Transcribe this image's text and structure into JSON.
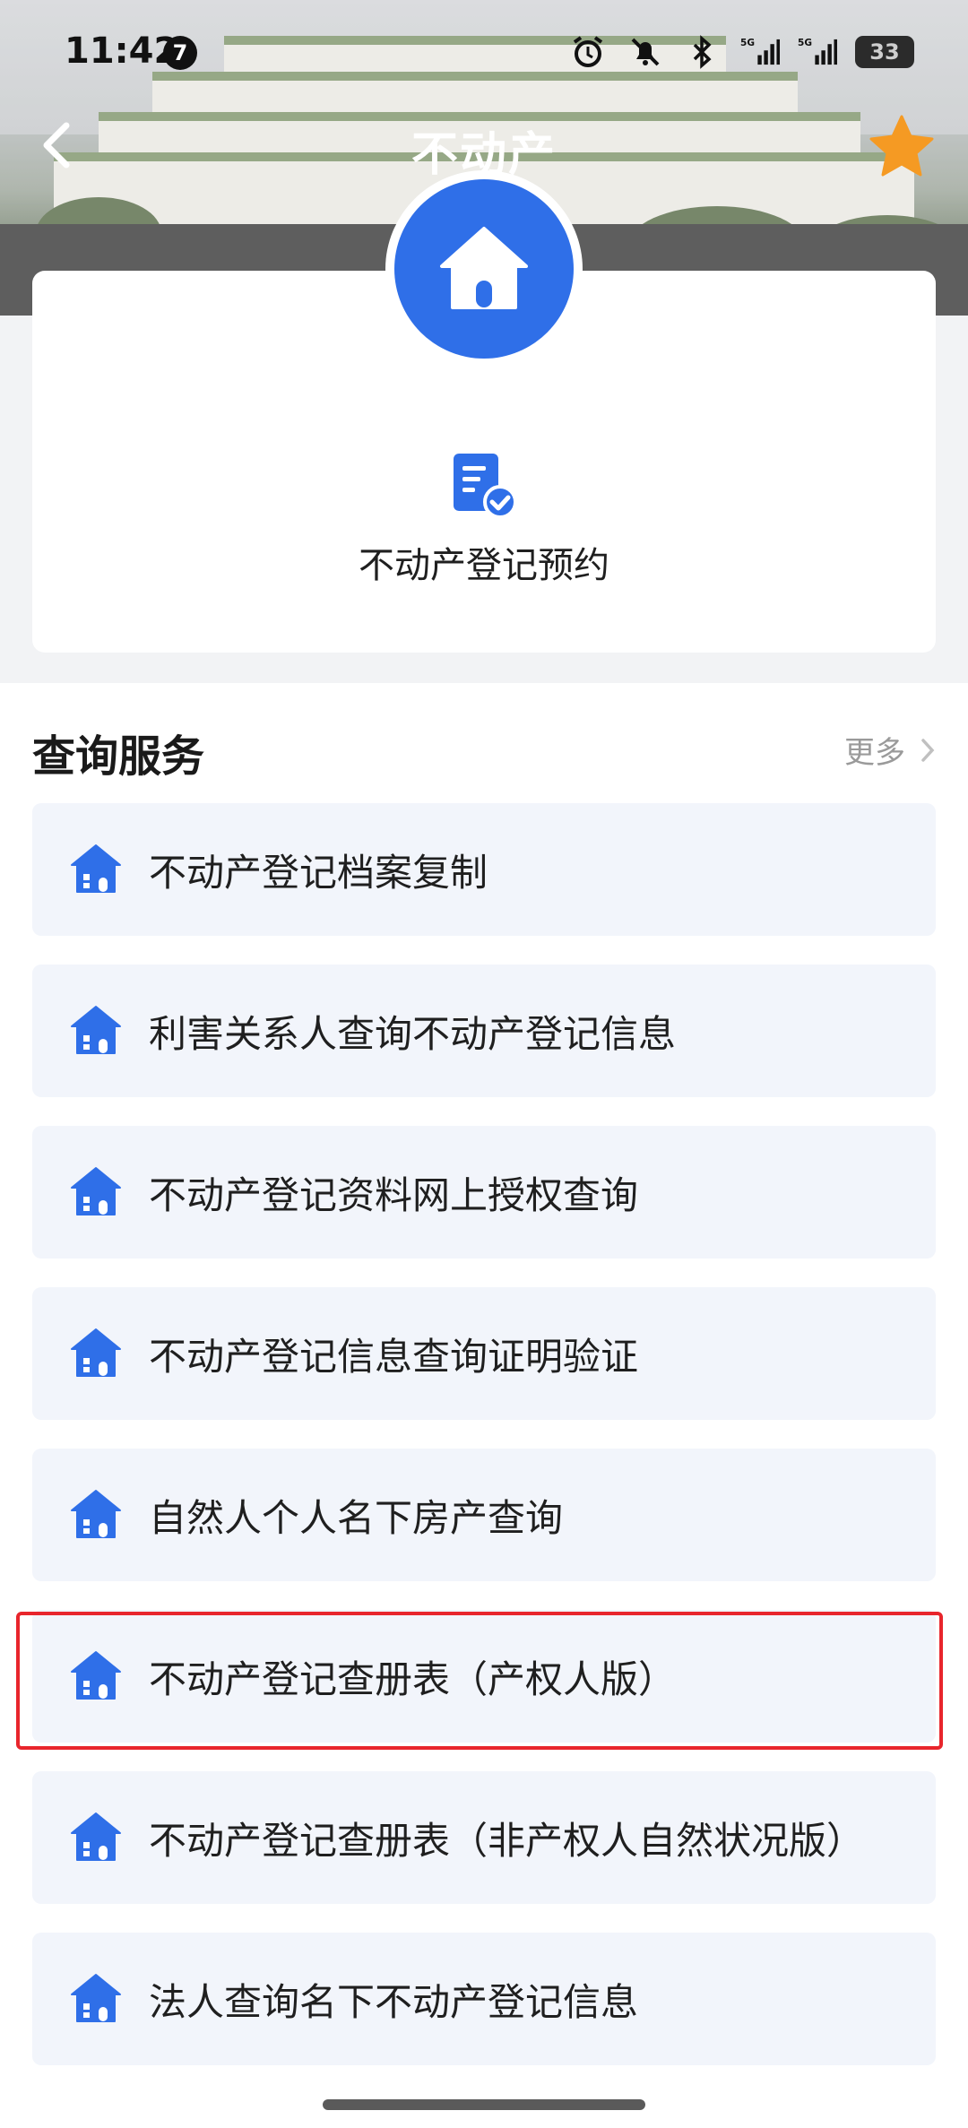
{
  "status_bar": {
    "time": "11:42",
    "notification_count": "7",
    "battery": "33",
    "network": "5G"
  },
  "nav": {
    "title": "不动产"
  },
  "top_card": {
    "appointment_label": "不动产登记预约"
  },
  "query_services": {
    "title": "查询服务",
    "more_label": "更多",
    "items": [
      {
        "label": "不动产登记档案复制"
      },
      {
        "label": "利害关系人查询不动产登记信息"
      },
      {
        "label": "不动产登记资料网上授权查询"
      },
      {
        "label": "不动产登记信息查询证明验证"
      },
      {
        "label": "自然人个人名下房产查询"
      },
      {
        "label": "不动产登记查册表（产权人版）"
      },
      {
        "label": "不动产登记查册表（非产权人自然状况版）"
      },
      {
        "label": "法人查询名下不动产登记信息"
      }
    ]
  },
  "colors": {
    "accent_blue": "#2f6fe8",
    "favorite_orange": "#f59a23",
    "highlight_red": "#e8252c",
    "item_bg": "#f2f5fb"
  }
}
